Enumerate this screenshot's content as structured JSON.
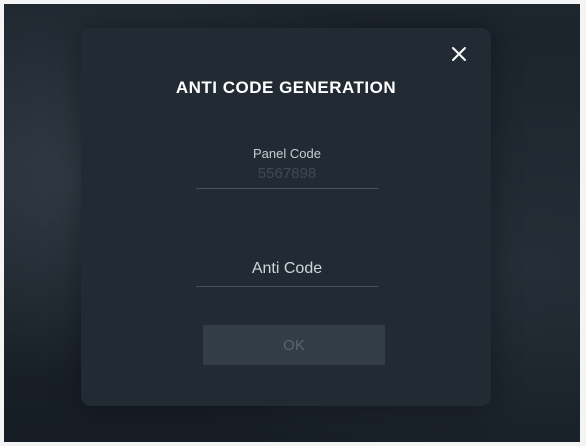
{
  "dialog": {
    "title": "ANTI CODE GENERATION",
    "close_icon": "close-icon"
  },
  "panel_code": {
    "label": "Panel Code",
    "value": "5567898"
  },
  "anti_code": {
    "placeholder": "Anti Code",
    "value": ""
  },
  "actions": {
    "ok_label": "OK"
  }
}
